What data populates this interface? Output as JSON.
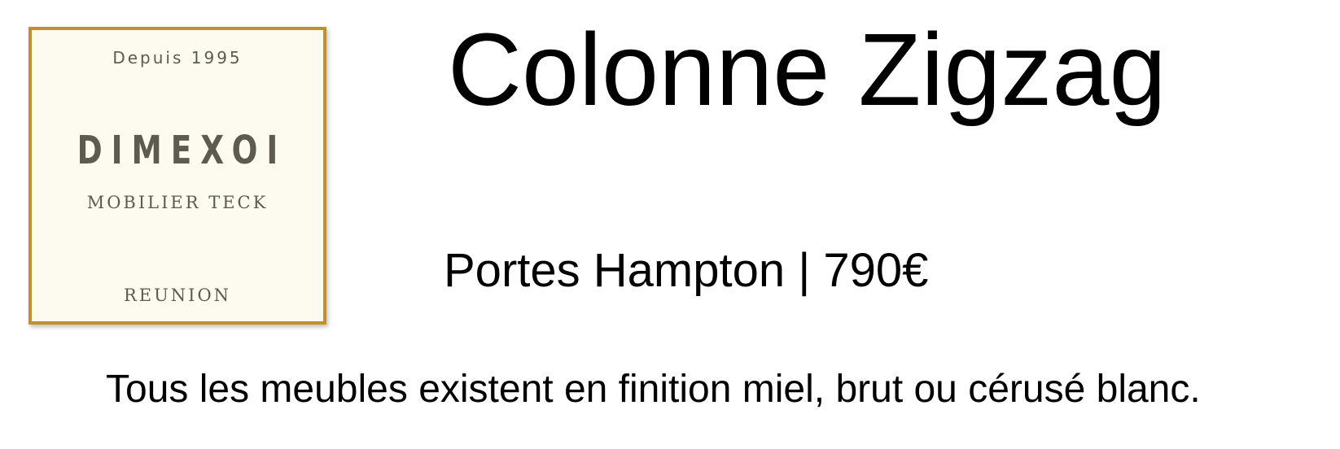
{
  "logo": {
    "since": "Depuis 1995",
    "brand": "DIMEXOI",
    "tagline": "MOBILIER TECK",
    "location": "REUNION",
    "border_color": "#c0902e",
    "background_color": "#fdfaf0",
    "text_color": "#5e5a50"
  },
  "product": {
    "title": "Colonne Zigzag",
    "subtitle": "Portes Hampton | 790€"
  },
  "footer": {
    "note": "Tous les meubles existent en finition miel, brut ou cérusé blanc."
  }
}
